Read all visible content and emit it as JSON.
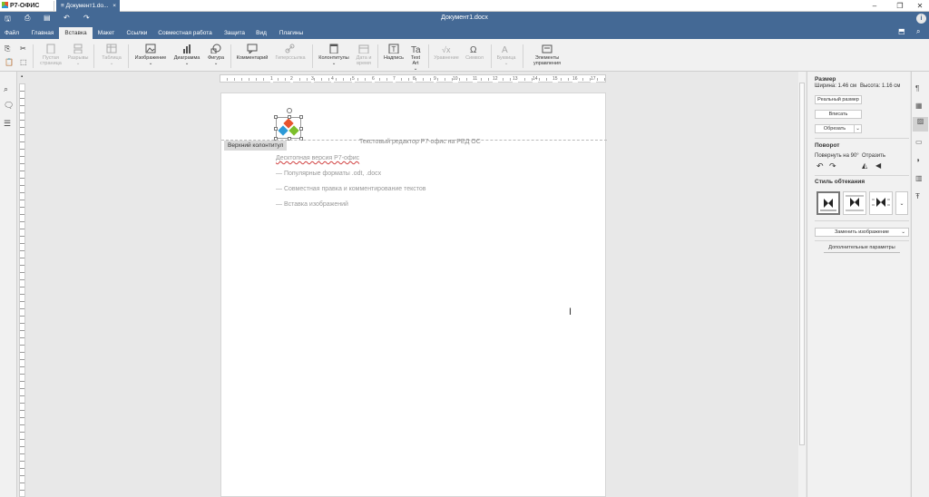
{
  "app": {
    "name": "Р7-ОФИС"
  },
  "tab": {
    "title": "Документ1.do...",
    "close": "×"
  },
  "window": {
    "minimize": "–",
    "restore": "❐",
    "close": "✕"
  },
  "header": {
    "title": "Документ1.docx",
    "user_icon": "i"
  },
  "menu": [
    {
      "label": "Файл"
    },
    {
      "label": "Главная"
    },
    {
      "label": "Вставка"
    },
    {
      "label": "Макет"
    },
    {
      "label": "Ссылки"
    },
    {
      "label": "Совместная работа"
    },
    {
      "label": "Защита"
    },
    {
      "label": "Вид"
    },
    {
      "label": "Плагины"
    }
  ],
  "ribbon": {
    "blank_page": "Пустая страница",
    "breaks": "Разрывы",
    "table": "Таблица",
    "image": "Изображение",
    "chart": "Диаграмма",
    "shape": "Фигура",
    "comment": "Комментарий",
    "hyperlink": "Гиперссылка",
    "headers": "Колонтитулы",
    "datetime": "Дата и время",
    "textbox": "Надпись",
    "textart": "Text Art",
    "equation": "Уравнение",
    "symbol": "Символ",
    "dropcap": "Буквица",
    "controls": "Элементы управления"
  },
  "ruler": {
    "nums": [
      "1",
      "2",
      "3",
      "4",
      "5",
      "6",
      "7",
      "8",
      "9",
      "10",
      "11",
      "12",
      "13",
      "14",
      "15",
      "16",
      "17"
    ]
  },
  "document": {
    "header_label": "Верхний колонтитул",
    "header_text": "Текстовый редактор Р7-офис на РЕД ОС",
    "lines": [
      "Десктопная версия Р7-офис",
      "— Популярные форматы .odt, .docx",
      "— Совместная правка и комментирование текстов",
      "— Вставка изображений"
    ]
  },
  "panel": {
    "size_title": "Размер",
    "width": "Ширина: 1.46 см",
    "height": "Высота: 1.16 см",
    "actual_size": "Реальный размер",
    "fit": "Вписать",
    "crop": "Обрезать",
    "rotation_title": "Поворот",
    "rotate90": "Повернуть на 90°",
    "flip": "Отразить",
    "wrap_title": "Стиль обтекания",
    "replace_image": "Заменить изображение",
    "advanced": "Дополнительные параметры"
  },
  "colors": {
    "accent": "#446995",
    "logo_red": "#e8542f",
    "logo_blue": "#2d9ad8",
    "logo_green": "#7cbf2a"
  }
}
